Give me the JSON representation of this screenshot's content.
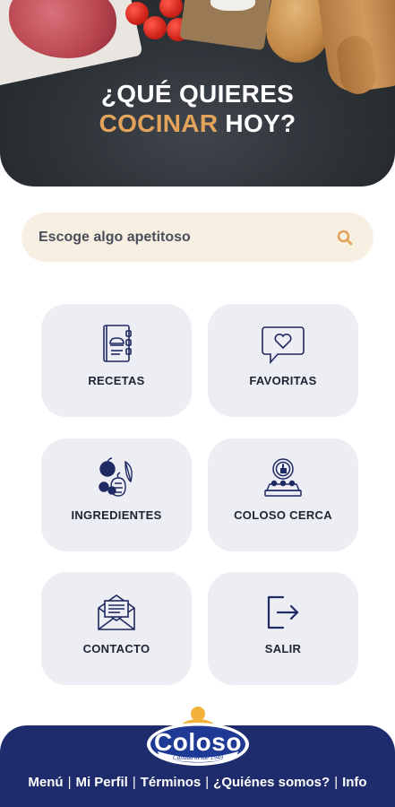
{
  "hero": {
    "title_line1": "¿QUÉ QUIERES",
    "title_accent": "COCINAR",
    "title_rest": " HOY?"
  },
  "search": {
    "placeholder": "Escoge algo apetitoso",
    "icon": "search-icon"
  },
  "tiles": [
    {
      "label": "RECETAS",
      "icon": "recipe-book-icon"
    },
    {
      "label": "FAVORITAS",
      "icon": "heart-speech-bubble-icon"
    },
    {
      "label": "INGREDIENTES",
      "icon": "vegetables-icon"
    },
    {
      "label": "COLOSO CERCA",
      "icon": "store-location-icon"
    },
    {
      "label": "CONTACTO",
      "icon": "envelope-icon"
    },
    {
      "label": "SALIR",
      "icon": "logout-icon"
    }
  ],
  "footer": {
    "logo_text": "Coloso",
    "logo_tagline": "Calidad desde 1949",
    "nav": [
      "Menú",
      "Mi Perfil",
      "Términos",
      "¿Quiénes somos?",
      "Info"
    ]
  },
  "colors": {
    "accent": "#e3a35b",
    "navy": "#1e2c6d",
    "tile_bg": "#eceef4",
    "search_bg": "#f7f0e2"
  }
}
